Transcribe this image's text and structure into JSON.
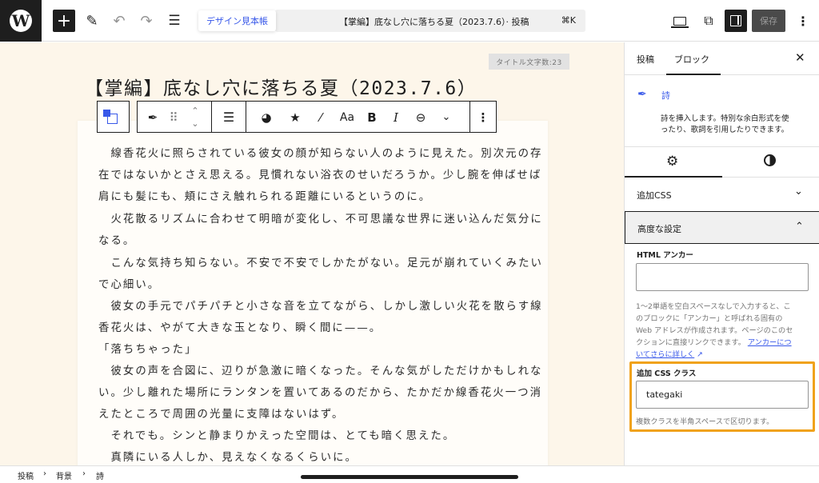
{
  "toolbar": {
    "add_icon": "plus-icon",
    "pattern_label": "デザイン見本帳",
    "command_title": "【掌編】底なし穴に落ちる夏（2023.7.6）· 投稿",
    "command_shortcut": "⌘K",
    "save_label": "保存"
  },
  "editor": {
    "char_count": "タイトル文字数:23",
    "post_title": "【掌編】底なし穴に落ちる夏（2023.7.6）",
    "poem_lines": [
      "　線香花火に照らされている彼女の顔が知らない人のように見えた。別次元の存",
      "在ではないかとさえ思える。見慣れない浴衣のせいだろうか。少し腕を伸ばせば",
      "肩にも髪にも、頬にさえ触れられる距離にいるというのに。",
      "　火花散るリズムに合わせて明暗が変化し、不可思議な世界に迷い込んだ気分に",
      "なる。",
      "　こんな気持ち知らない。不安で不安でしかたがない。足元が崩れていくみたい",
      "で心細い。",
      "　彼女の手元でパチパチと小さな音を立てながら、しかし激しい火花を散らす線",
      "香花火は、やがて大きな玉となり、瞬く間に——。",
      "「落ちちゃった」",
      "　彼女の声を合図に、辺りが急激に暗くなった。そんな気がしただけかもしれな",
      "い。少し離れた場所にランタンを置いてあるのだから、たかだか線香花火一つ消",
      "えたところで周囲の光量に支障はないはず。",
      "　それでも。シンと静まりかえった空間は、とても暗く思えた。",
      "　真隣にいる人しか、見えなくなるくらいに。"
    ]
  },
  "sidebar": {
    "tab_post": "投稿",
    "tab_block": "ブロック",
    "block_name": "詩",
    "block_desc": [
      "詩を挿入します。特別な余白形式を使",
      "ったり、歌詞を引用したりできます。"
    ],
    "panel_css": "追加CSS",
    "panel_advanced": "高度な設定",
    "html_anchor_label": "HTML アンカー",
    "html_anchor_value": "",
    "anchor_help": [
      "1〜2単語を空白スペースなしで入力すると、こ",
      "のブロックに「アンカー」と呼ばれる固有の",
      "Web アドレスが作成されます。ページのこのセ",
      "クションに直接リンクできます。"
    ],
    "anchor_link_part1": "アンカーにつ",
    "anchor_link_part2": "いてさらに詳しく",
    "css_class_label": "追加 CSS クラス",
    "css_class_value": "tategaki",
    "css_class_help": "複数クラスを半角スペースで区切ります。"
  },
  "breadcrumb": [
    "投稿",
    "背景",
    "詩"
  ],
  "colors": {
    "accent": "#3858e9",
    "highlight": "#f0a21b",
    "canvas": "#fdf6ea"
  }
}
